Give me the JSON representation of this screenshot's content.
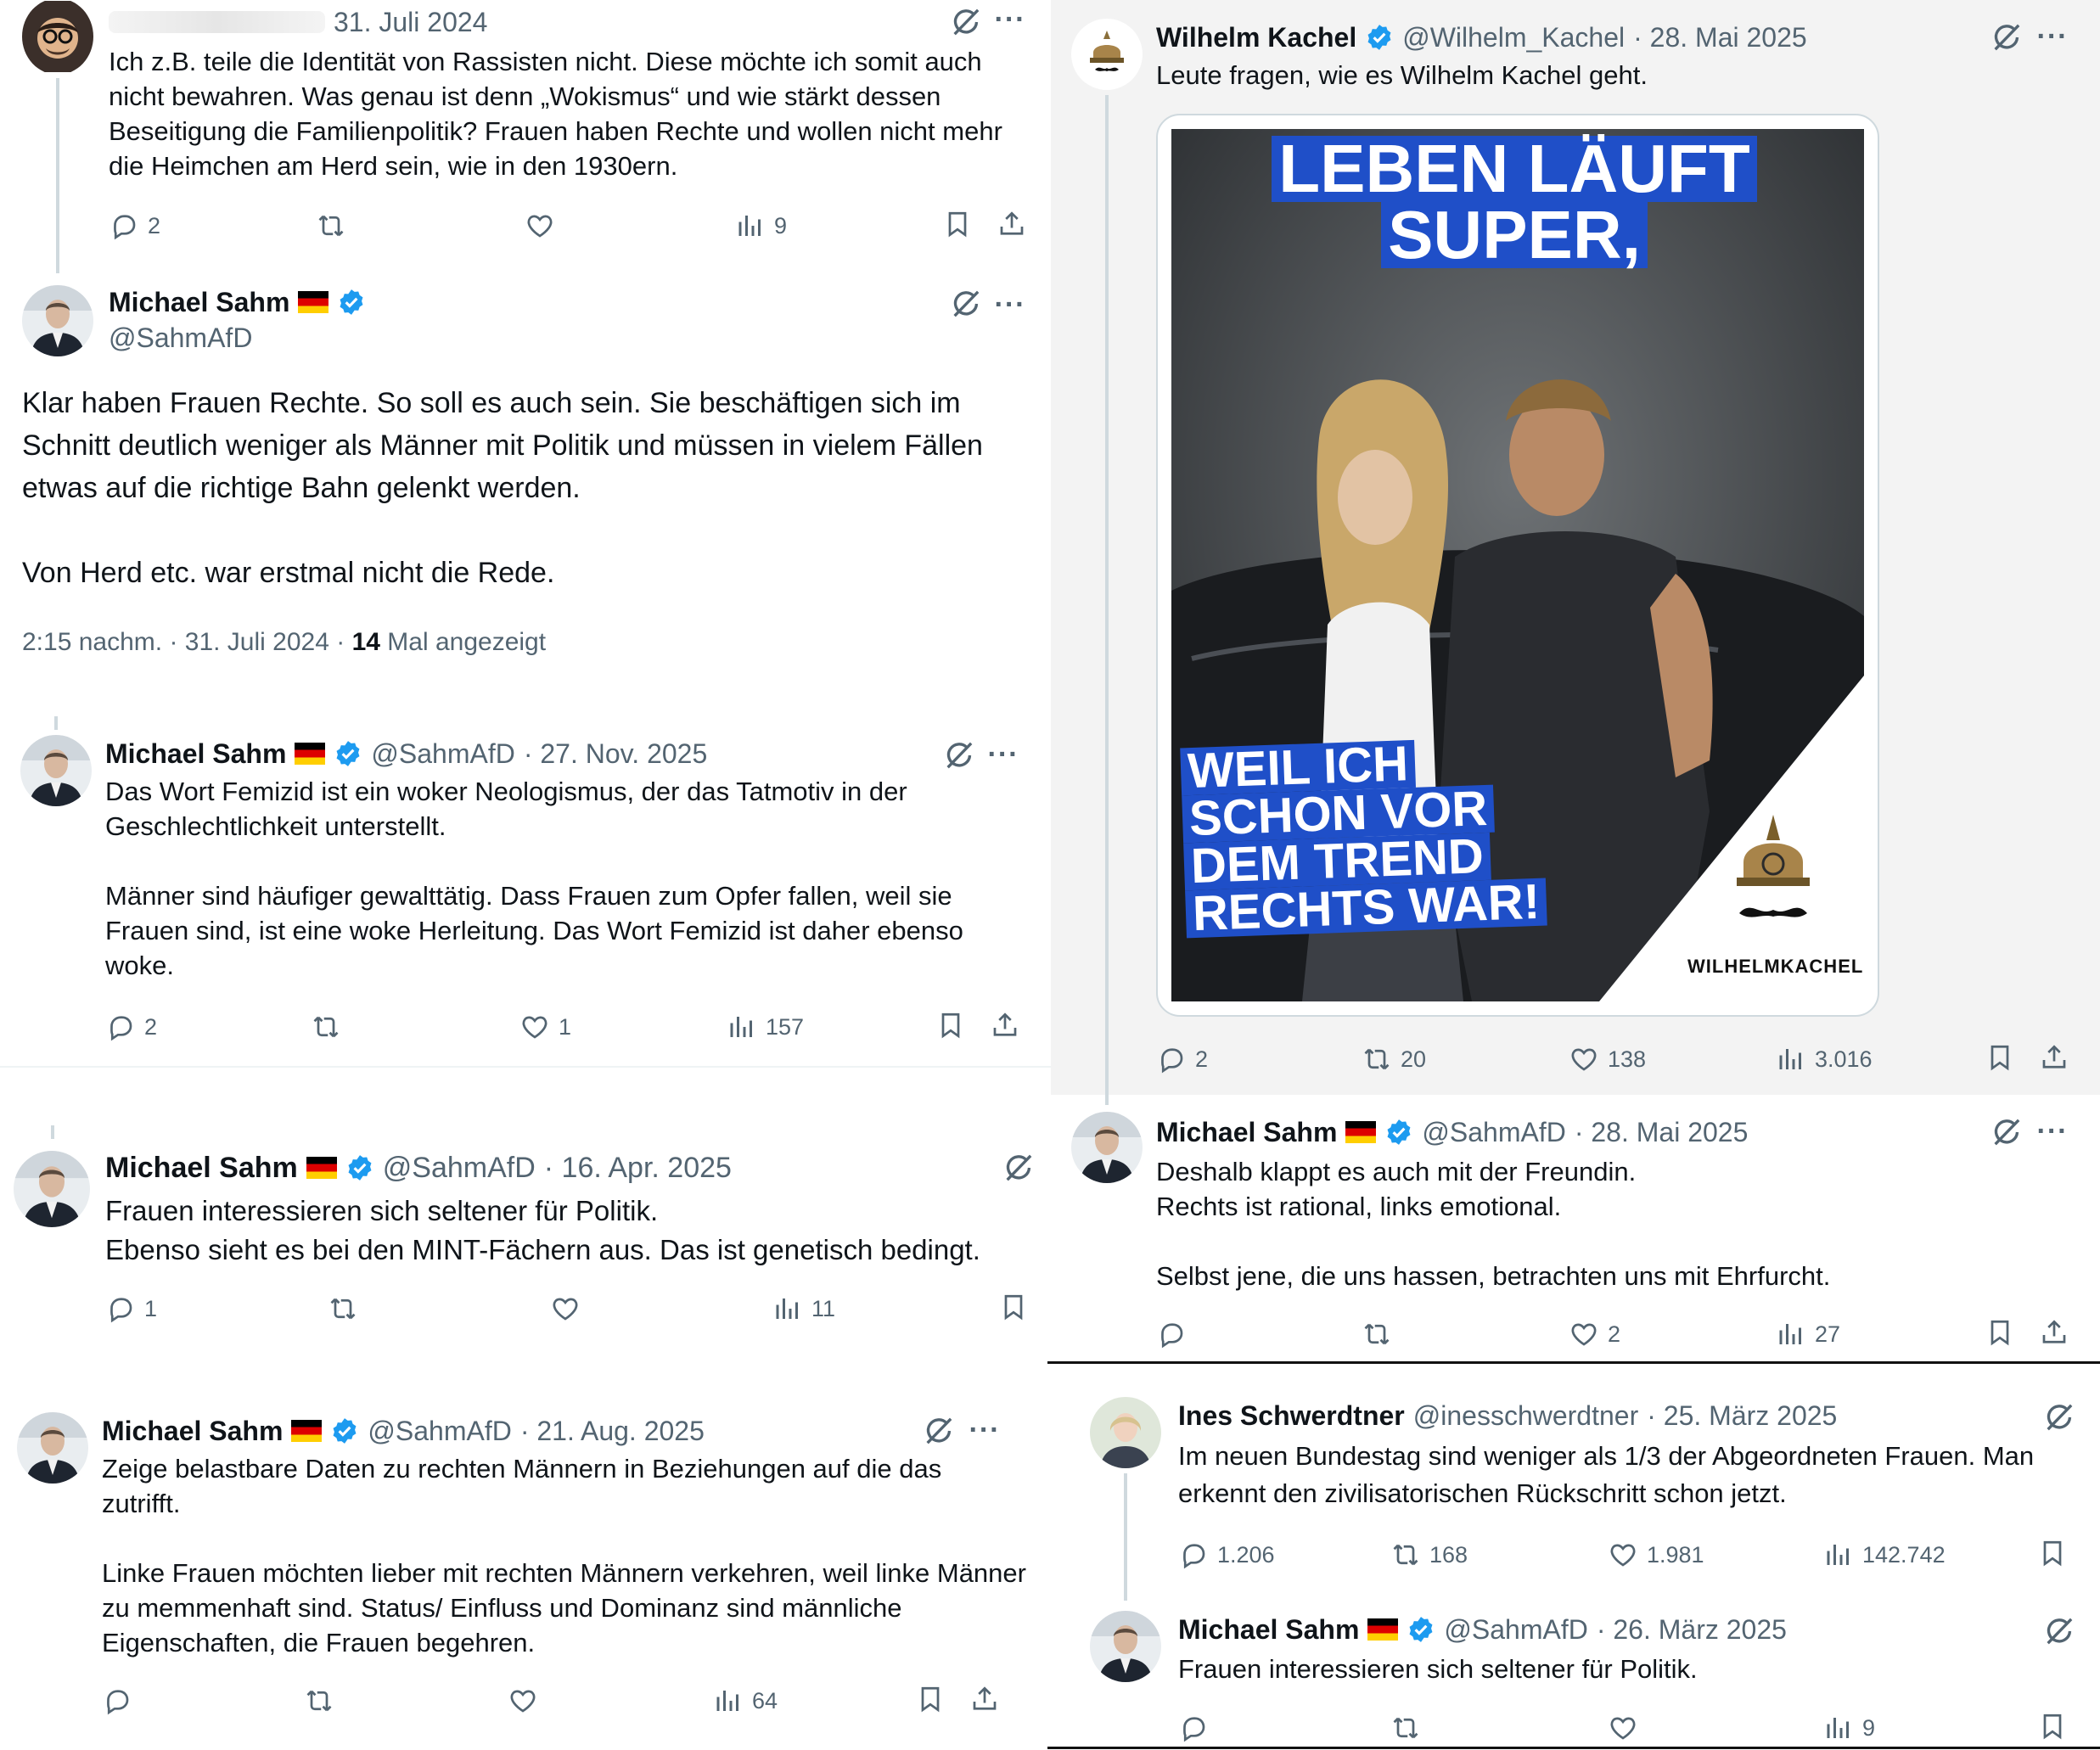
{
  "left": {
    "tweet1": {
      "date": "31. Juli 2024",
      "text": "Ich z.B. teile die Identität von Rassisten nicht. Diese möchte ich somit auch nicht bewahren. Was genau ist denn „Wokismus“ und wie stärkt dessen Beseitigung die Familienpolitik? Frauen haben Rechte und wollen nicht mehr die Heimchen am Herd sein, wie in den 1930ern.",
      "replies": "2",
      "retweets": "",
      "likes": "",
      "views": "9"
    },
    "main": {
      "name": "Michael Sahm",
      "handle": "@SahmAfD",
      "text": "Klar haben Frauen Rechte. So soll es auch sein. Sie beschäftigen sich im Schnitt deutlich weniger als Männer mit Politik und müssen in vielem Fällen etwas auf die richtige Bahn gelenkt werden.\n\nVon Herd etc. war erstmal nicht die Rede.",
      "time": "2:15 nachm. · 31. Juli 2024 ·",
      "views_count": "14",
      "views_label": "Mal angezeigt"
    },
    "tweet3": {
      "name": "Michael Sahm",
      "handle": "@SahmAfD",
      "date": "· 27. Nov. 2025",
      "text": "Das Wort Femizid ist ein woker Neologismus, der das Tatmotiv in der Geschlechtlichkeit unterstellt.\n\nMänner sind häufiger gewalttätig. Dass Frauen zum Opfer fallen, weil sie Frauen sind, ist eine woke Herleitung. Das Wort Femizid ist daher ebenso woke.",
      "replies": "2",
      "retweets": "",
      "likes": "1",
      "views": "157"
    },
    "tweet4": {
      "name": "Michael Sahm",
      "handle": "@SahmAfD",
      "date": "· 16. Apr. 2025",
      "text": "Frauen interessieren sich seltener für Politik.\nEbenso sieht es bei den MINT-Fächern aus. Das ist genetisch bedingt.",
      "replies": "1",
      "retweets": "",
      "likes": "",
      "views": "11"
    },
    "tweet5": {
      "name": "Michael Sahm",
      "handle": "@SahmAfD",
      "date": "· 21. Aug. 2025",
      "text": "Zeige belastbare Daten zu rechten Männern in Beziehungen auf die das zutrifft.\n\nLinke Frauen möchten lieber mit rechten Männern verkehren, weil linke Männer zu memmenhaft sind. Status/ Einfluss und Dominanz sind männliche Eigenschaften, die Frauen begehren.",
      "replies": "",
      "retweets": "",
      "likes": "",
      "views": "64"
    }
  },
  "right": {
    "kachel": {
      "name": "Wilhelm Kachel",
      "handle": "@Wilhelm_Kachel",
      "date": "· 28. Mai 2025",
      "text": "Leute fragen, wie es Wilhelm Kachel geht.",
      "poster_top_line1": "LEBEN LÄUFT",
      "poster_top_line2": "SUPER,",
      "poster_bottom_line1": "WEIL ICH",
      "poster_bottom_line2": "SCHON VOR",
      "poster_bottom_line3": "DEM TREND",
      "poster_bottom_line4": "RECHTS WAR!",
      "logo_text": "WILHELMKACHEL",
      "replies": "2",
      "retweets": "20",
      "likes": "138",
      "views": "3.016"
    },
    "sahm_reply": {
      "name": "Michael Sahm",
      "handle": "@SahmAfD",
      "date": "· 28. Mai 2025",
      "text": "Deshalb klappt es auch mit der Freundin.\nRechts ist rational, links emotional.\n\nSelbst jene, die uns hassen, betrachten uns mit Ehrfurcht.",
      "replies": "",
      "retweets": "",
      "likes": "2",
      "views": "27"
    },
    "ines": {
      "name": "Ines Schwerdtner",
      "handle": "@inesschwerdtner",
      "date": "· 25. März 2025",
      "text": "Im neuen Bundestag sind weniger als 1/3 der Abgeordneten Frauen. Man erkennt den zivilisatorischen Rückschritt schon jetzt.",
      "replies": "1.206",
      "retweets": "168",
      "likes": "1.981",
      "views": "142.742"
    },
    "sahm_last": {
      "name": "Michael Sahm",
      "handle": "@SahmAfD",
      "date": "· 26. März 2025",
      "text": "Frauen interessieren sich seltener für Politik.",
      "replies": "",
      "retweets": "",
      "likes": "",
      "views": "9"
    }
  },
  "colors": {
    "verified": "#1d9bf0",
    "muted": "#536471",
    "text": "#0f1419",
    "poster_blue": "#1f4fc8"
  }
}
